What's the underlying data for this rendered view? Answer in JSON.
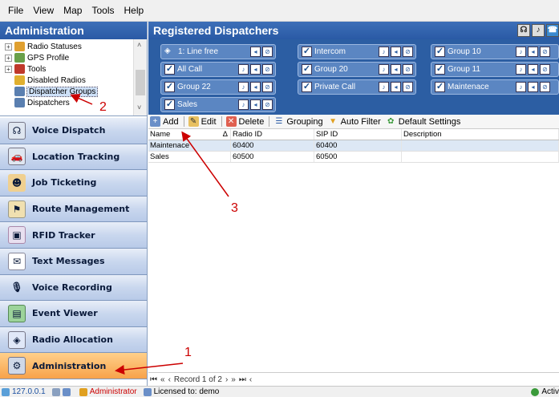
{
  "menu": [
    "File",
    "View",
    "Map",
    "Tools",
    "Help"
  ],
  "left_panel": {
    "title": "Administration",
    "tree": [
      {
        "label": "Radio Statuses",
        "expander": "+",
        "icon_color": "#e0a030"
      },
      {
        "label": "GPS Profile",
        "expander": "+",
        "icon_color": "#6aa04a"
      },
      {
        "label": "Tools",
        "expander": "+",
        "icon_color": "#c0392b"
      },
      {
        "label": "Disabled Radios",
        "expander": "",
        "icon_color": "#e0b030"
      },
      {
        "label": "Dispatcher Groups",
        "expander": "",
        "icon_color": "#5a7fb0"
      },
      {
        "label": "Dispatchers",
        "expander": "",
        "icon_color": "#5a7fb0"
      }
    ],
    "nav": [
      {
        "label": "Voice Dispatch",
        "icon": "headset-icon"
      },
      {
        "label": "Location Tracking",
        "icon": "car-icon"
      },
      {
        "label": "Job Ticketing",
        "icon": "people-icon"
      },
      {
        "label": "Route Management",
        "icon": "route-icon"
      },
      {
        "label": "RFID Tracker",
        "icon": "rfid-icon"
      },
      {
        "label": "Text Messages",
        "icon": "envelope-icon"
      },
      {
        "label": "Voice Recording",
        "icon": "microphone-icon"
      },
      {
        "label": "Event Viewer",
        "icon": "event-icon"
      },
      {
        "label": "Radio Allocation",
        "icon": "radio-icon"
      },
      {
        "label": "Administration",
        "icon": "admin-icon"
      }
    ]
  },
  "right_panel": {
    "title": "Registered Dispatchers",
    "groups": [
      {
        "label": "1: Line free",
        "kind": "speaker"
      },
      {
        "label": "Intercom",
        "kind": "check"
      },
      {
        "label": "Group 10",
        "kind": "check"
      },
      {
        "label": "All Call",
        "kind": "check"
      },
      {
        "label": "Group 20",
        "kind": "check"
      },
      {
        "label": "Group 11",
        "kind": "check"
      },
      {
        "label": "Group 22",
        "kind": "check"
      },
      {
        "label": "Private Call",
        "kind": "check"
      },
      {
        "label": "Maintenace",
        "kind": "check"
      },
      {
        "label": "Sales",
        "kind": "check"
      }
    ],
    "toolbar": {
      "add": "Add",
      "edit": "Edit",
      "delete": "Delete",
      "grouping": "Grouping",
      "auto_filter": "Auto Filter",
      "default_settings": "Default Settings"
    },
    "table": {
      "columns": [
        "Name",
        "Radio ID",
        "SIP ID",
        "Description"
      ],
      "sort_indicator": "Δ",
      "rows": [
        [
          "Maintenace",
          "60400",
          "60400",
          ""
        ],
        [
          "Sales",
          "60500",
          "60500",
          ""
        ]
      ]
    },
    "navigator": {
      "record_text": "Record 1 of 2"
    }
  },
  "statusbar": {
    "ip": "127.0.0.1",
    "user": "Administrator",
    "license": "Licensed to: demo",
    "state": "Activ"
  },
  "annotations": {
    "one": "1",
    "two": "2",
    "three": "3"
  },
  "colors": {
    "header_blue": "#2a5aa5",
    "active_orange": "#f7a24a",
    "annotation_red": "#c00000"
  }
}
